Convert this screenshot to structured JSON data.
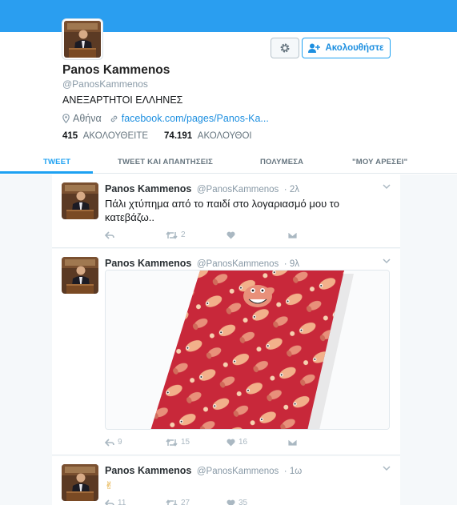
{
  "profile": {
    "name": "Panos Kammenos",
    "handle": "@PanosKammenos",
    "bio": "ΑΝΕΞΑΡΤΗΤΟΙ ΕΛΛΗΝΕΣ",
    "location": "Αθήνα",
    "link": "facebook.com/pages/Panos-Ka...",
    "following_count": "415",
    "following_label": "ΑΚΟΛΟΥΘΕΙΤΕ",
    "followers_count": "74.191",
    "followers_label": "ΑΚΟΛΟΥΘΟΙ",
    "follow_button": "Ακολουθήστε"
  },
  "tabs": [
    {
      "label": "TWEET",
      "active": true
    },
    {
      "label": "TWEET ΚΑΙ ΑΠΑΝΤΗΣΕΙΣ",
      "active": false
    },
    {
      "label": "ΠΟΛΥΜΕΣΑ",
      "active": false
    },
    {
      "label": "\"ΜΟΥ ΑΡΕΣΕΙ\"",
      "active": false
    }
  ],
  "tweets": [
    {
      "name": "Panos Kammenos",
      "handle": "@PanosKammenos",
      "time": "· 2λ",
      "text": "Πάλι χτύπημα από το παιδί στο λογαριασμό μου το κατεβάζω..",
      "replies": "",
      "retweets": "2",
      "likes": ""
    },
    {
      "name": "Panos Kammenos",
      "handle": "@PanosKammenos",
      "time": "· 9λ",
      "text": "",
      "replies": "9",
      "retweets": "15",
      "likes": "16"
    },
    {
      "name": "Panos Kammenos",
      "handle": "@PanosKammenos",
      "time": "· 1ω",
      "text": "✌",
      "replies": "11",
      "retweets": "27",
      "likes": "35"
    }
  ],
  "colors": {
    "accent": "#1da1f2",
    "banner": "#2a9ef0",
    "tie": "#c8283a"
  },
  "icons": [
    "gear-icon",
    "add-user-icon",
    "location-icon",
    "link-icon",
    "reply-icon",
    "retweet-icon",
    "like-icon",
    "dm-icon",
    "chevron-down-icon"
  ]
}
